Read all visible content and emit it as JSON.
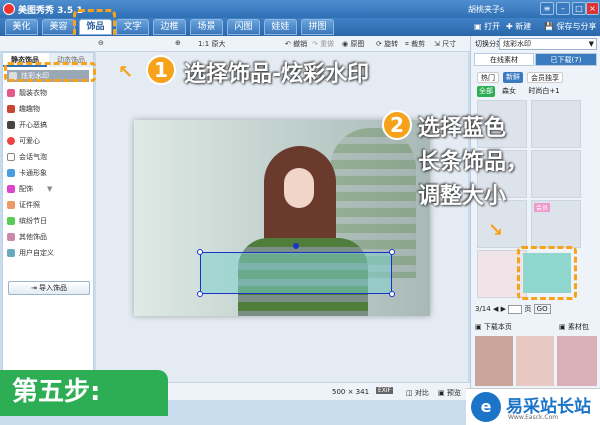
{
  "window": {
    "title": "美图秀秀 3.5.1",
    "user": "胡桃夹子s"
  },
  "menu": {
    "tabs": [
      "美化",
      "美容",
      "饰品",
      "文字",
      "边框",
      "场景",
      "闪图",
      "娃娃",
      "拼图"
    ],
    "active": "饰品",
    "open": "打开",
    "new": "新建",
    "save": "保存与分享"
  },
  "toolbar": {
    "zoom": "1:1 原大",
    "undo": "撤销",
    "redo": "重做",
    "original": "原图",
    "rotate": "旋转",
    "crop": "裁剪",
    "size": "尺寸"
  },
  "left": {
    "tab_static": "静态饰品",
    "tab_dynamic": "动态饰品",
    "items": [
      "炫彩水印",
      "靓装衣物",
      "趣趣物",
      "开心恶搞",
      "可爱心",
      "会话气泡",
      "卡通形象",
      "配饰",
      "证件照",
      "缤纷节日",
      "其他饰品",
      "用户自定义"
    ],
    "import": "导入饰品"
  },
  "right": {
    "sort_label": "切换分类",
    "sort_value": "炫彩水印",
    "tab_online": "在线素材",
    "tab_downloaded": "已下载(7)",
    "chips": [
      "热门",
      "新鲜",
      "会员独享",
      "全部",
      "森女",
      "时尚白+1"
    ],
    "page": "3/14",
    "page_suffix": "页",
    "go": "GO",
    "download_page": "下载本页",
    "library": "素材包",
    "badge_top": "会员"
  },
  "status": {
    "dims": "500 × 341",
    "exif": "EXIF",
    "compare": "对比",
    "preview": "预览"
  },
  "annotations": {
    "step1_num": "1",
    "step1_text": "选择饰品-炫彩水印",
    "step2_num": "2",
    "step2_text_1": "选择蓝色",
    "step2_text_2": "长条饰品，",
    "step2_text_3": "调整大小"
  },
  "step": {
    "label": "第五步:"
  },
  "watermark": {
    "site": "易采站长站",
    "site_sub": "Www.Easck.Com"
  },
  "colors": {
    "accent": "#f6a21a",
    "brand": "#2f6fb4",
    "step": "#2eae54"
  }
}
